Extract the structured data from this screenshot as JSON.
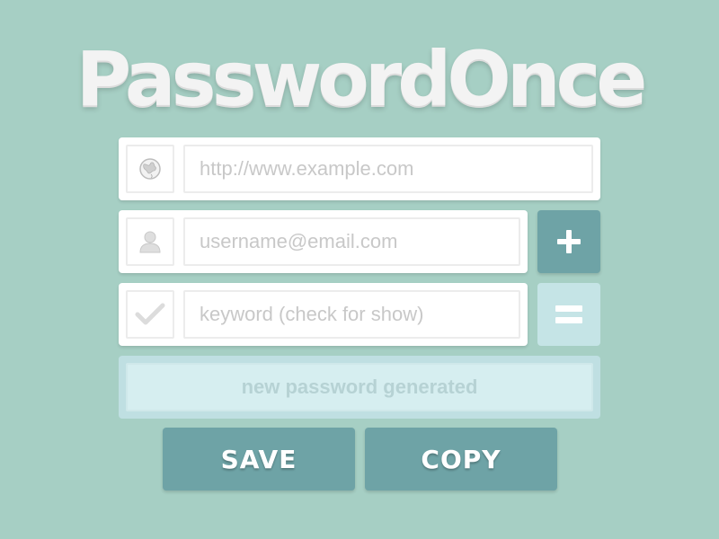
{
  "app": {
    "title": "PasswordOnce"
  },
  "form": {
    "url_field": {
      "placeholder": "http://www.example.com",
      "icon": "globe-icon"
    },
    "user_field": {
      "placeholder": "username@email.com",
      "icon": "user-icon"
    },
    "keyword_field": {
      "placeholder": "keyword (check for show)",
      "icon": "check-icon"
    },
    "add_button": {
      "symbol": "+",
      "icon": "plus-icon"
    },
    "generate_button": {
      "symbol": "=",
      "icon": "equals-icon"
    },
    "result": {
      "text": "new password generated"
    }
  },
  "actions": {
    "save_label": "SAVE",
    "copy_label": "COPY"
  },
  "colors": {
    "background": "#a6cfc4",
    "accent": "#6ea3a6",
    "accent_light": "#c5e4e6",
    "result_bg": "#d6eef0",
    "placeholder": "#c8c8c8"
  }
}
